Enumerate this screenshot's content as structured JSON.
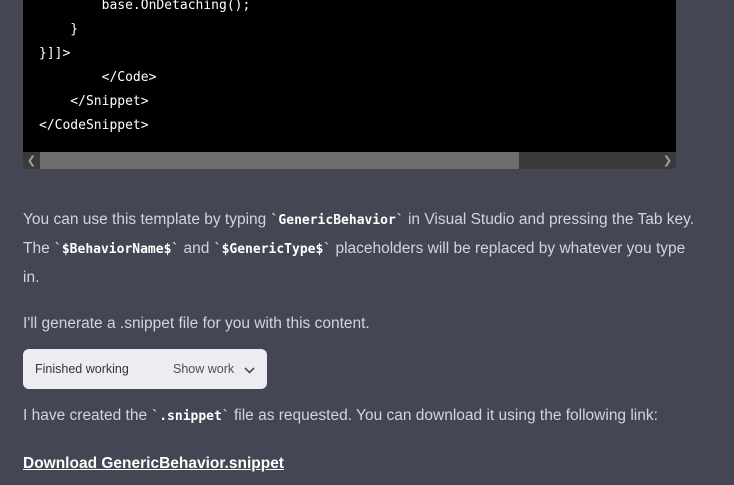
{
  "code_block": {
    "lines": [
      "        base.OnDetaching();",
      "    }",
      "}]]>",
      "        </Code>",
      "    </Snippet>",
      "</CodeSnippet>"
    ]
  },
  "paragraph1": {
    "part1": "You can use this template by typing ",
    "code1": "GenericBehavior",
    "part2": " in Visual Studio and pressing the Tab key. The ",
    "code2": "$BehaviorName$",
    "part3": " and ",
    "code3": "$GenericType$",
    "part4": " placeholders will be replaced by whatever you type in."
  },
  "paragraph2": "I'll generate a .snippet file for you with this content.",
  "status": {
    "label": "Finished working",
    "show_work_label": "Show work"
  },
  "paragraph3": {
    "part1": "I have created the ",
    "code": ".snippet",
    "part2": " file as requested. You can download it using the following link:"
  },
  "download_link": "Download GenericBehavior.snippet"
}
